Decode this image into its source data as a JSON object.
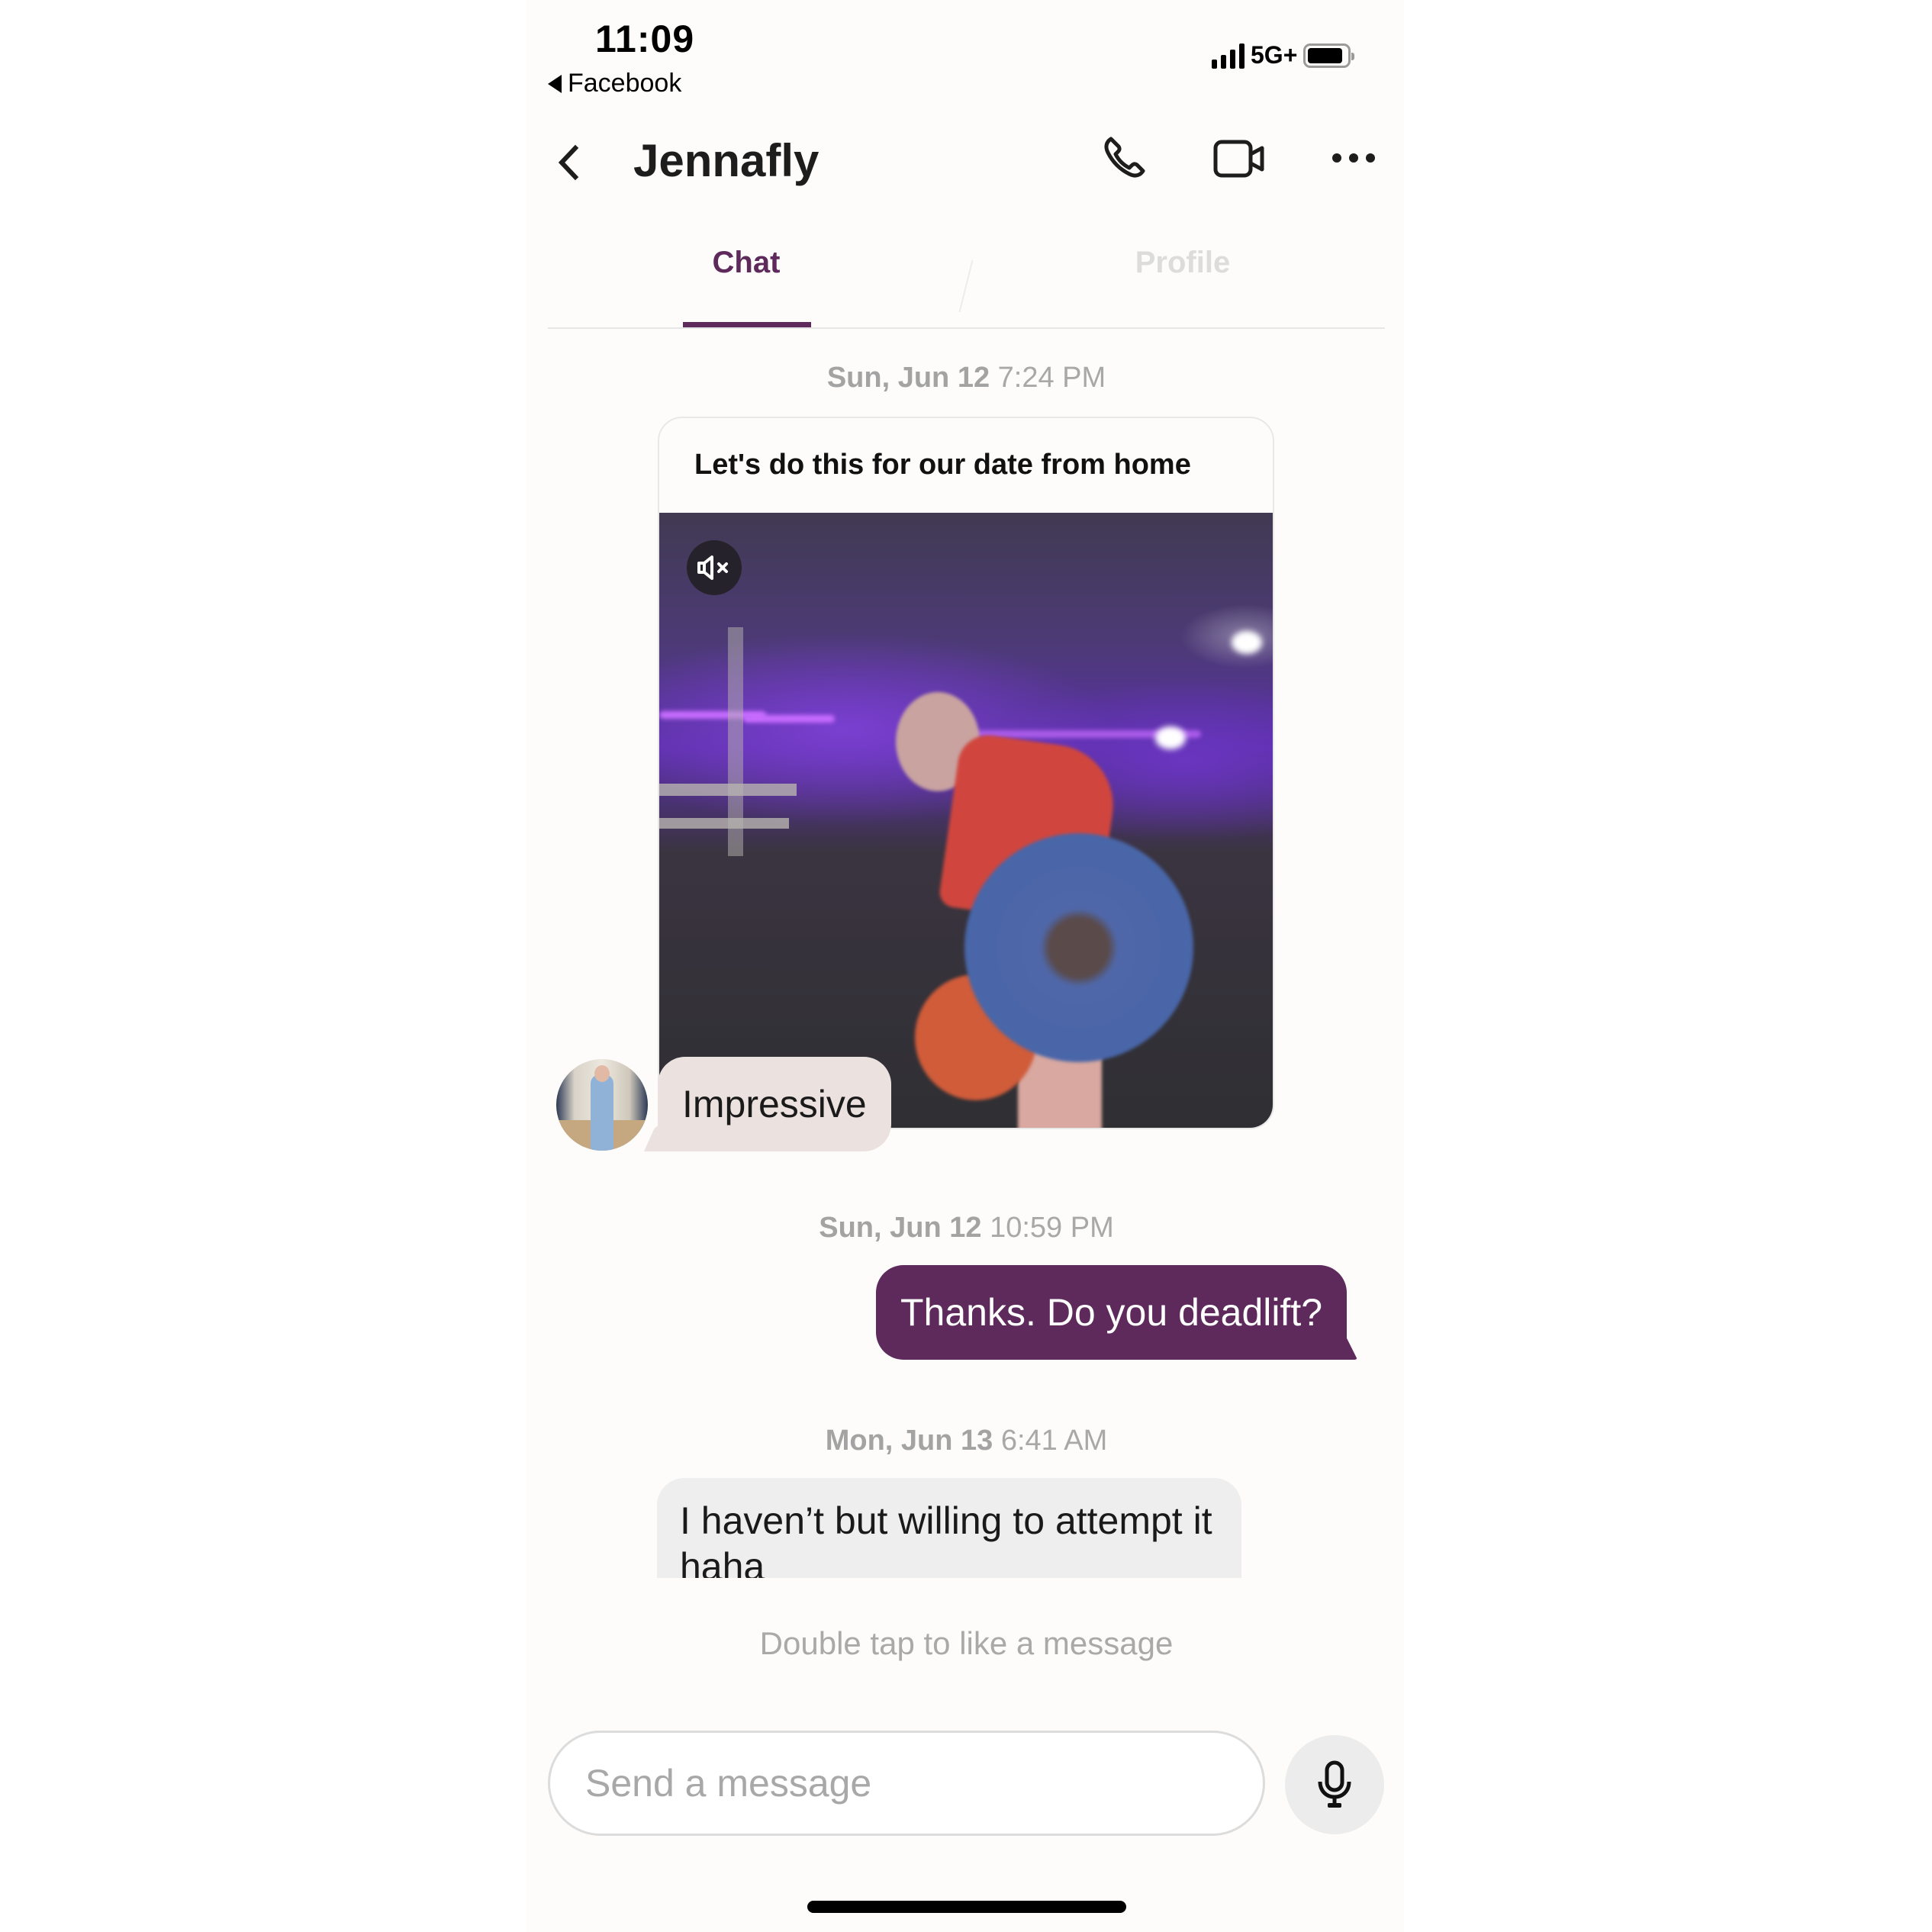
{
  "status_bar": {
    "time": "11:09",
    "back_app": "Facebook",
    "network": "5G+",
    "signal_bars": 4,
    "battery_level_percent": 90
  },
  "header": {
    "title": "Jennafly",
    "icons": [
      "back-chevron-icon",
      "phone-icon",
      "video-camera-icon",
      "more-dots-icon"
    ]
  },
  "tabs": [
    {
      "label": "Chat",
      "active": true
    },
    {
      "label": "Profile",
      "active": false
    }
  ],
  "colors": {
    "brand_purple": "#5e2a5c",
    "received_bubble": "#ebe1df",
    "received_bubble_plain": "#eeeeee",
    "timestamp_gray": "#a8a8a8"
  },
  "messages": [
    {
      "timestamp_day": "Sun, Jun 12",
      "timestamp_time": "7:24 PM",
      "type": "shared_video",
      "caption": "Let's do this for our date from home",
      "video_muted": true,
      "reply": {
        "direction": "received",
        "text": "Impressive"
      }
    },
    {
      "timestamp_day": "Sun, Jun 12",
      "timestamp_time": "10:59 PM",
      "direction": "sent",
      "text": "Thanks. Do you deadlift?"
    },
    {
      "timestamp_day": "Mon, Jun 13",
      "timestamp_time": "6:41 AM",
      "direction": "received",
      "text": "I haven’t but willing to attempt it haha"
    }
  ],
  "hint": "Double tap to like a message",
  "composer": {
    "placeholder": "Send a message",
    "value": ""
  }
}
